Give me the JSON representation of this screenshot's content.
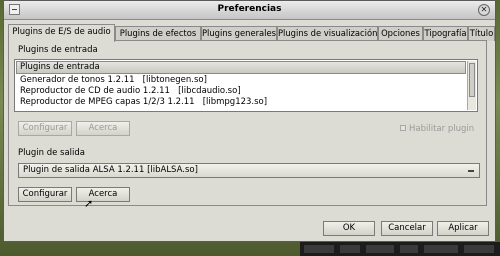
{
  "window": {
    "title": "Preferencias"
  },
  "tabs": [
    {
      "label": "Plugins de E/S de audio",
      "active": true
    },
    {
      "label": "Plugins de efectos",
      "active": false
    },
    {
      "label": "Plugins generales",
      "active": false
    },
    {
      "label": "Plugins de visualización",
      "active": false
    },
    {
      "label": "Opciones",
      "active": false
    },
    {
      "label": "Tipografía",
      "active": false
    },
    {
      "label": "Título",
      "active": false
    }
  ],
  "input_section": {
    "title": "Plugins de entrada",
    "list_header": "Plugins de entrada",
    "items": [
      "Generador de tonos 1.2.11   [libtonegen.so]",
      "Reproductor de CD de audio 1.2.11   [libcdaudio.so]",
      "Reproductor de MPEG capas 1/2/3 1.2.11   [libmpg123.so]"
    ],
    "configure_label": "Configurar",
    "about_label": "Acerca",
    "enable_label": "Habilitar plugin",
    "enable_checked": false
  },
  "output_section": {
    "title": "Plugin de salida",
    "selected": "Plugin de salida ALSA 1.2.11   [libALSA.so]",
    "configure_label": "Configurar",
    "about_label": "Acerca"
  },
  "dialog_buttons": {
    "ok": "OK",
    "cancel": "Cancelar",
    "apply": "Aplicar"
  }
}
